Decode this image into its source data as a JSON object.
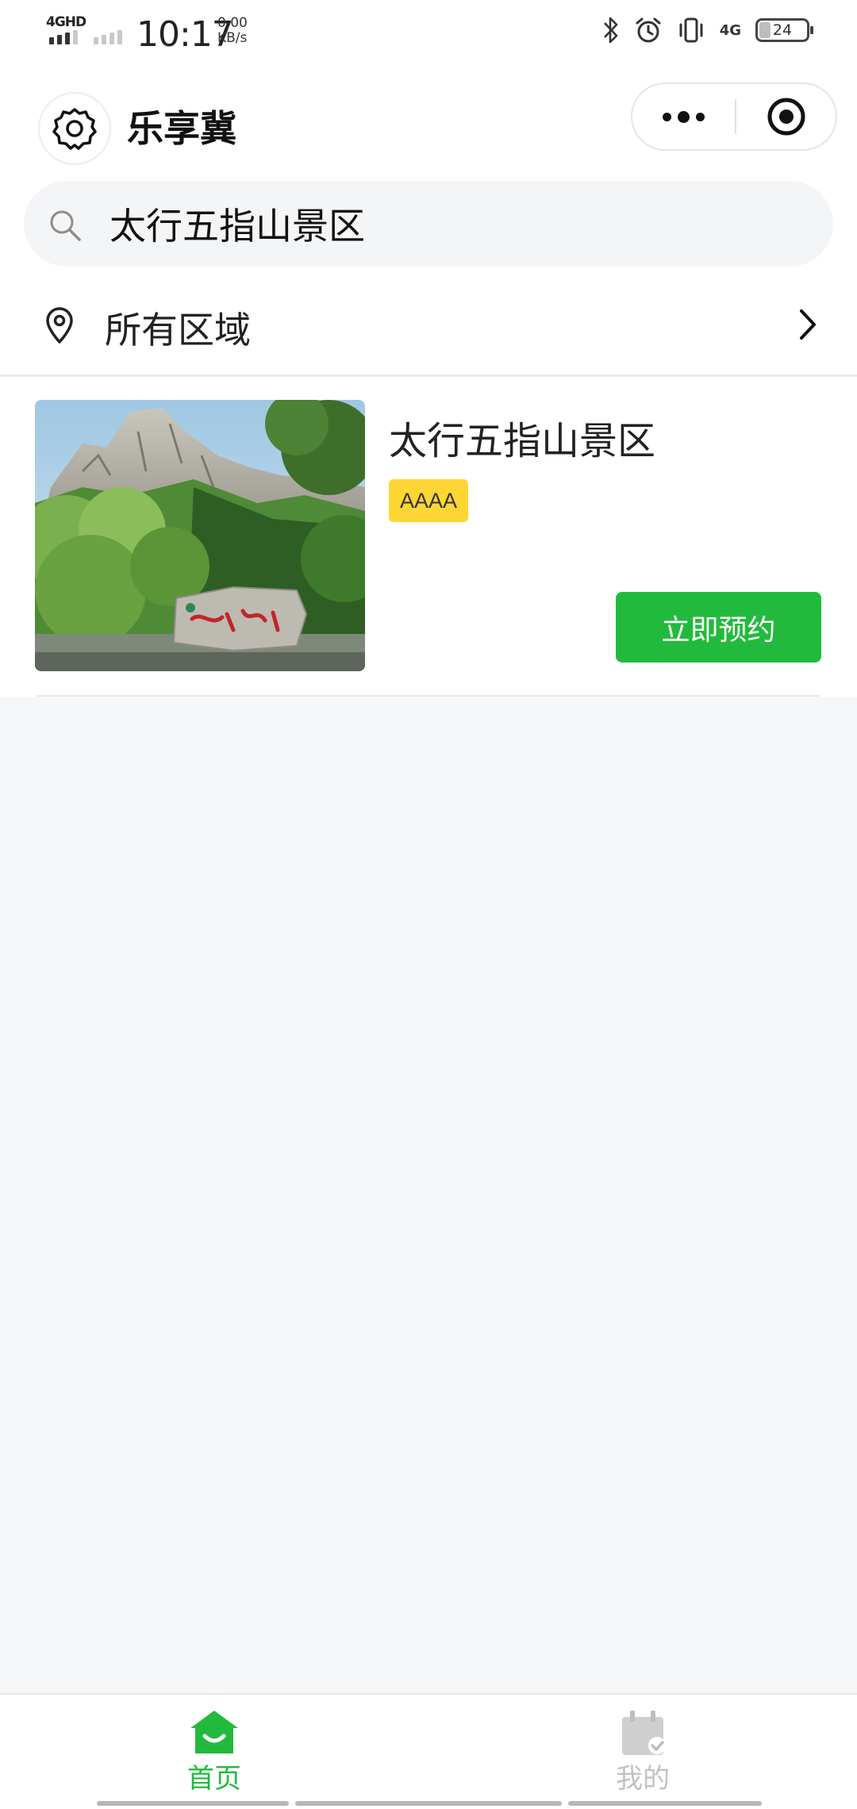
{
  "status_bar": {
    "network": "4GHD",
    "time": "10:17",
    "speed_value": "0.00",
    "speed_unit": "KB/s",
    "network_right": "4G",
    "battery": "24"
  },
  "nav": {
    "title": "乐享冀"
  },
  "search": {
    "value": "太行五指山景区"
  },
  "region": {
    "label": "所有区域"
  },
  "results": [
    {
      "name": "太行五指山景区",
      "level": "AAAA",
      "action": "立即预约"
    }
  ],
  "tabbar": {
    "items": [
      {
        "label": "首页",
        "active": true
      },
      {
        "label": "我的",
        "active": false
      }
    ]
  },
  "colors": {
    "accent_green": "#22ba3d",
    "badge_yellow": "#fcd634",
    "page_bg": "#f6f7f9"
  }
}
